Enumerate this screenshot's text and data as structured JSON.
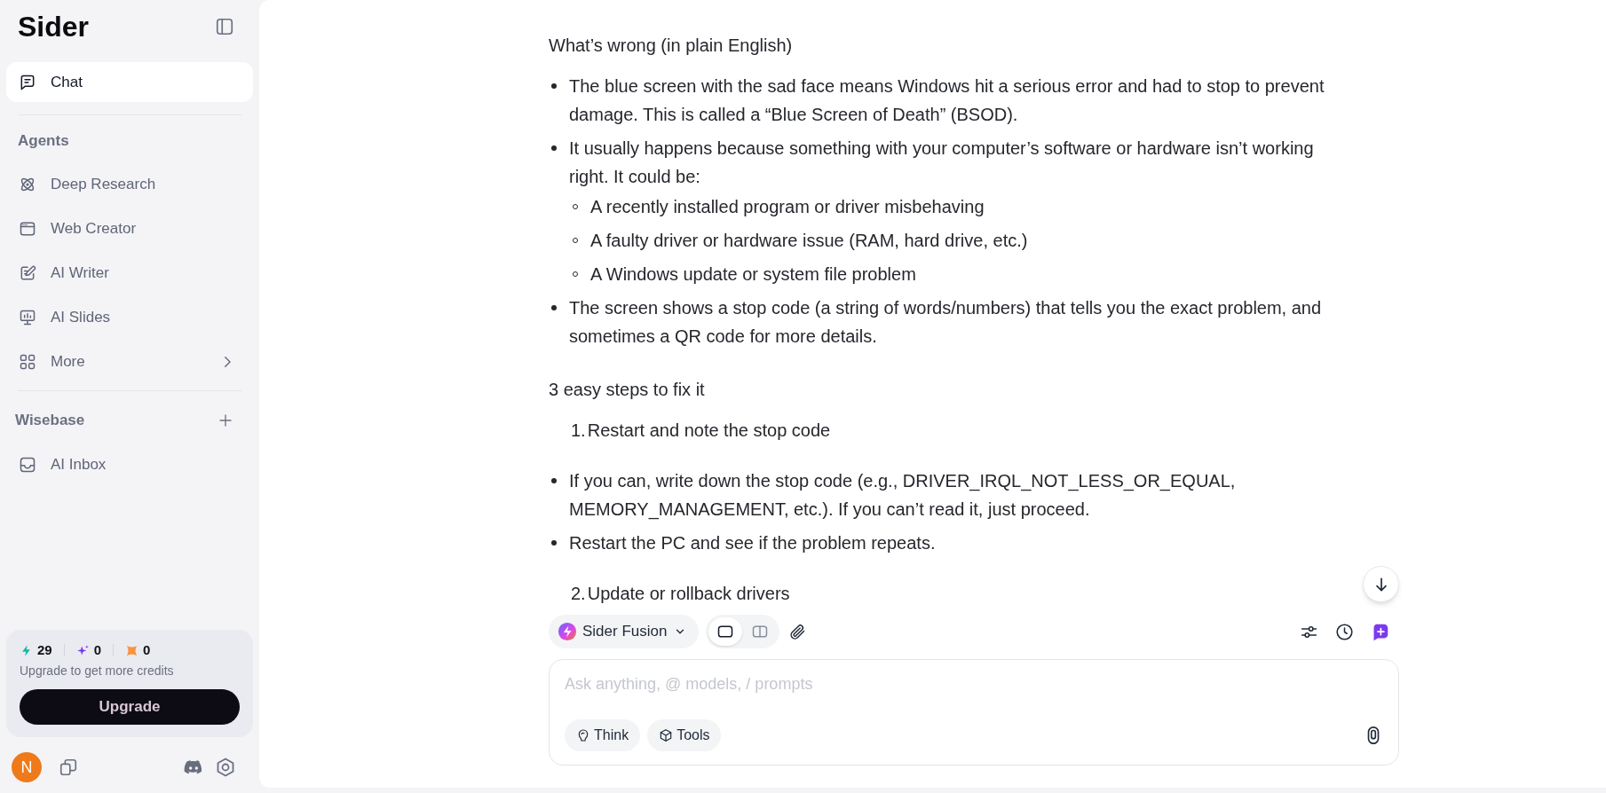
{
  "sidebar": {
    "logo": "Sider",
    "main": [
      {
        "label": "Chat",
        "selected": true
      }
    ],
    "agents": {
      "title": "Agents",
      "items": [
        {
          "label": "Deep Research",
          "kind": "link",
          "selected": false
        },
        {
          "label": "Web Creator",
          "kind": "link",
          "selected": false
        },
        {
          "label": "AI Writer",
          "kind": "link",
          "selected": false
        },
        {
          "label": "AI Slides",
          "kind": "link",
          "selected": false
        },
        {
          "label": "More",
          "kind": "submenu",
          "selected": false
        }
      ]
    },
    "wisebase": {
      "title": "Wisebase",
      "items": [
        {
          "label": "AI Inbox",
          "selected": false
        }
      ]
    },
    "credits": {
      "counts": [
        "29",
        "0",
        "0"
      ],
      "note": "Upgrade to get more credits",
      "button": "Upgrade"
    },
    "user": {
      "initial": "N"
    }
  },
  "message": {
    "blocks": [
      {
        "kind": "paragraph",
        "text": "What’s wrong (in plain English)"
      },
      {
        "kind": "bullets",
        "items": [
          {
            "text": "The blue screen with the sad face means Windows hit a serious error and had to stop to prevent damage. This is called a “Blue Screen of Death” (BSOD)."
          },
          {
            "text": "It usually happens because something with your computer’s software or hardware isn’t working right. It could be:",
            "children": [
              {
                "text": "A recently installed program or driver misbehaving"
              },
              {
                "text": "A faulty driver or hardware issue (RAM, hard drive, etc.)"
              },
              {
                "text": "A Windows update or system file problem"
              }
            ]
          },
          {
            "text": "The screen shows a stop code (a string of words/numbers) that tells you the exact problem, and sometimes a QR code for more details."
          }
        ]
      },
      {
        "kind": "paragraph",
        "text": "3 easy steps to fix it"
      },
      {
        "kind": "numbered",
        "items": [
          {
            "marker": "1.",
            "text": "Restart and note the stop code"
          }
        ]
      },
      {
        "kind": "bullets",
        "items": [
          {
            "text": "If you can, write down the stop code (e.g., DRIVER_IRQL_NOT_LESS_OR_EQUAL, MEMORY_MANAGEMENT, etc.). If you can’t read it, just proceed."
          },
          {
            "text": "Restart the PC and see if the problem repeats."
          }
        ]
      },
      {
        "kind": "numbered",
        "items": [
          {
            "marker": "2.",
            "text": "Update or rollback drivers"
          }
        ]
      }
    ]
  },
  "composer": {
    "model": "Sider Fusion",
    "view_modes": [
      {
        "selected": true
      },
      {
        "selected": false
      }
    ],
    "input": {
      "placeholder": "Ask anything, @ models, / prompts"
    },
    "chips": [
      "Think",
      "Tools"
    ]
  }
}
